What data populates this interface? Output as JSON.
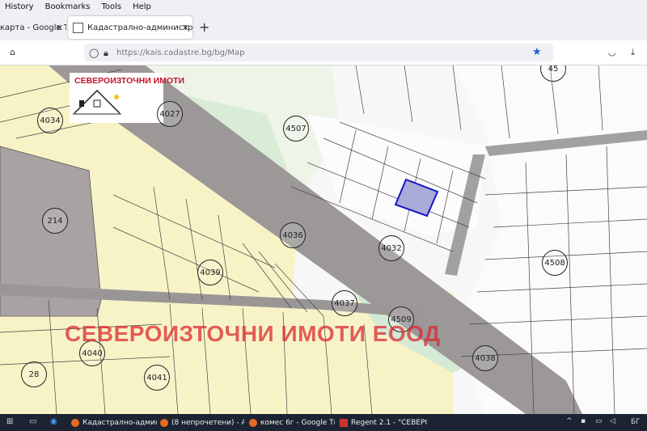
{
  "menu": {
    "history": "History",
    "bookmarks": "Bookmarks",
    "tools": "Tools",
    "help": "Help"
  },
  "tabs": [
    {
      "title": "карта - Google Ть"
    },
    {
      "title": "Кадастрално-административ"
    }
  ],
  "url": "https://kais.cadastre.bg/bg/Map",
  "map": {
    "logo_text": "СЕВЕРОИЗТОЧНИ ИМОТИ",
    "watermark": "СЕВЕРОИЗТОЧНИ ИМОТИ ЕООД",
    "labels": {
      "l4034": "4034",
      "l4027": "4027",
      "l4507": "4507",
      "l214": "214",
      "l4036": "4036",
      "l4032": "4032",
      "l4039": "4039",
      "l4037": "4037",
      "l4509": "4509",
      "l4508": "4508",
      "l4040": "4040",
      "l28": "28",
      "l4041": "4041",
      "l4038": "4038",
      "l45": "45"
    }
  },
  "taskbar": {
    "items": [
      "Кадастрално-админ...",
      "(8 непрочетени) - Аб...",
      "комес 6г - Google Ть...",
      "Regent 2.1 - \"СЕВЕРО..."
    ],
    "lang": "БГ"
  }
}
